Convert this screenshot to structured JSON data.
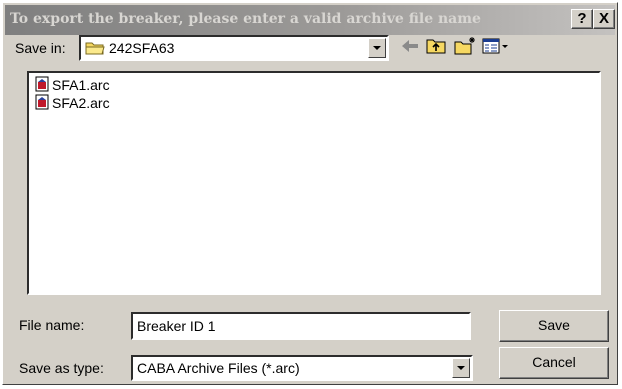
{
  "window": {
    "title": "To export the breaker, please enter a valid archive file name",
    "help_label": "?",
    "close_label": "X"
  },
  "save_in": {
    "label": "Save in:",
    "value": "242SFA63",
    "icon": "folder-icon"
  },
  "toolbar": {
    "back_icon": "back-arrow-icon",
    "up_icon": "up-folder-icon",
    "new_folder_icon": "new-folder-icon",
    "view_icon": "view-menu-icon"
  },
  "files": [
    {
      "name": "SFA1.arc",
      "icon": "archive-file-icon"
    },
    {
      "name": "SFA2.arc",
      "icon": "archive-file-icon"
    }
  ],
  "file_name": {
    "label": "File name:",
    "value": "Breaker ID 1"
  },
  "save_as_type": {
    "label": "Save as type:",
    "value": "CABA Archive Files (*.arc)"
  },
  "buttons": {
    "save": "Save",
    "cancel": "Cancel"
  }
}
